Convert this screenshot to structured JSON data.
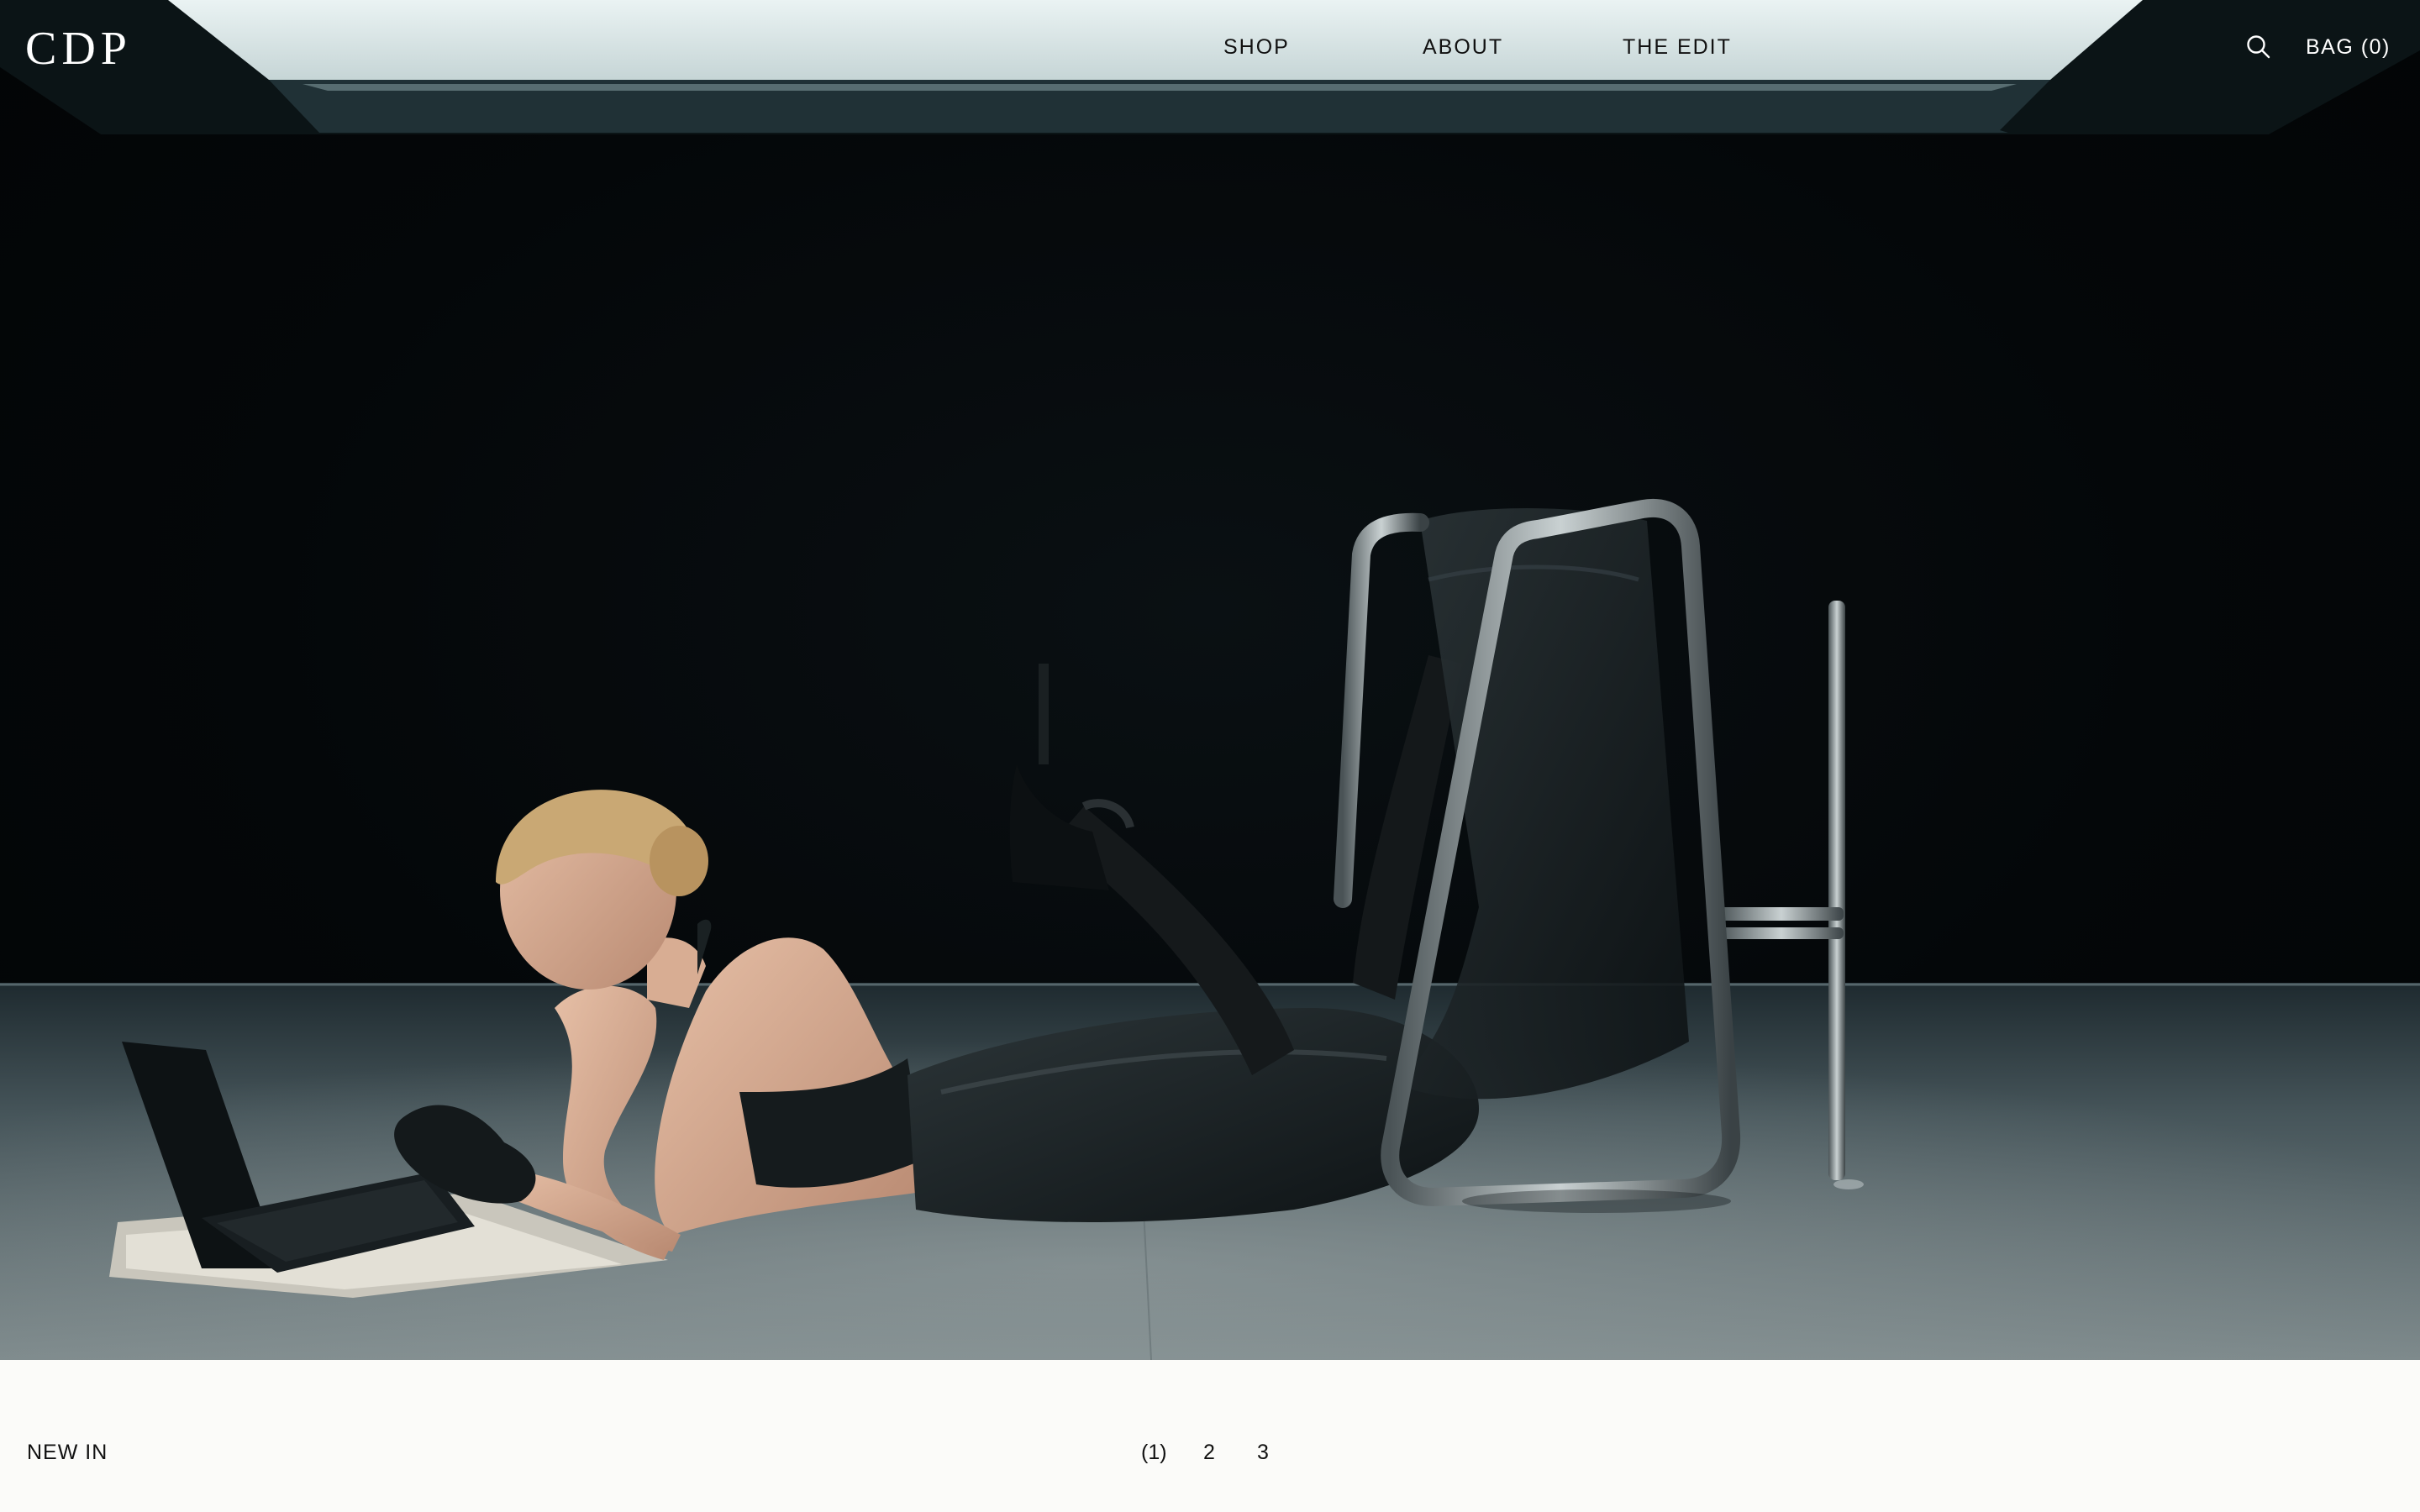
{
  "brand": {
    "logo": "CDP"
  },
  "nav": {
    "items": [
      {
        "label": "SHOP"
      },
      {
        "label": "ABOUT"
      },
      {
        "label": "THE EDIT"
      }
    ]
  },
  "utility": {
    "search_icon": "search-icon",
    "bag_label": "BAG (0)"
  },
  "section": {
    "label": "NEW IN"
  },
  "pagination": {
    "pages": [
      "(1)",
      "2",
      "3"
    ],
    "current": 1
  },
  "colors": {
    "page_background": "#fbfbf9",
    "text_dark": "#111111",
    "text_light": "#ffffff",
    "hero_background": "#040709"
  }
}
